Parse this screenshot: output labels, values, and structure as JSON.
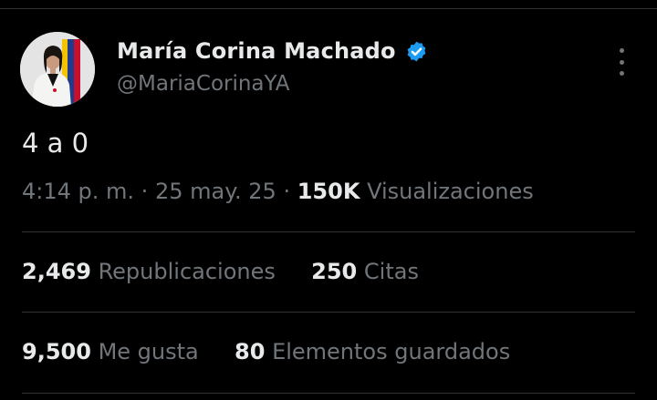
{
  "author": {
    "name": "María Corina Machado",
    "handle": "@MariaCorinaYA",
    "verified_color": "#1d9bf0"
  },
  "tweet": {
    "text": "4 a 0",
    "time": "4:14 p. m.",
    "separator": "·",
    "date": "25 may. 25",
    "views_count": "150K",
    "views_label": "Visualizaciones"
  },
  "stats": {
    "reposts_count": "2,469",
    "reposts_label": "Republicaciones",
    "quotes_count": "250",
    "quotes_label": "Citas",
    "likes_count": "9,500",
    "likes_label": "Me gusta",
    "bookmarks_count": "80",
    "bookmarks_label": "Elementos guardados"
  },
  "icons": {
    "verified": "verified-badge-icon",
    "more": "more-options-icon"
  },
  "colors": {
    "background": "#000000",
    "text_primary": "#e7e9ea",
    "text_secondary": "#71767b",
    "divider": "#2f3336"
  }
}
